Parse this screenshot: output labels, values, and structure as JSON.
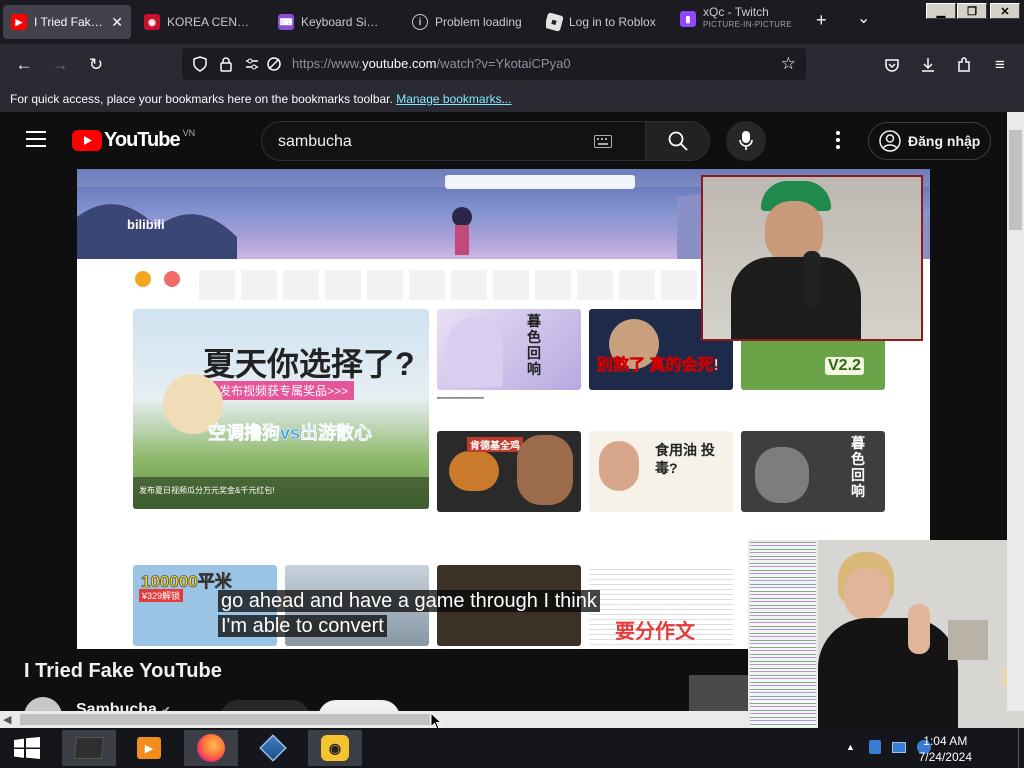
{
  "browser": {
    "tabs": [
      {
        "label": "I Tried Fake YouTube",
        "icon": "youtube-icon",
        "active": true
      },
      {
        "label": "KOREA CENTRAL",
        "icon": "korea-central-icon"
      },
      {
        "label": "Keyboard Simulator",
        "icon": "keyboard-app-icon"
      },
      {
        "label": "Problem loading",
        "icon": "info-icon"
      },
      {
        "label": "Log in to Roblox",
        "icon": "roblox-icon"
      },
      {
        "label": "xQc - Twitch",
        "sublabel": "PICTURE-IN-PICTURE",
        "icon": "twitch-icon"
      }
    ],
    "new_tab_symbol": "+",
    "tab_list_symbol": "⌄",
    "window_controls": {
      "minimize": "▁",
      "maximize": "❐",
      "close": "✕"
    },
    "url_dim_prefix": "https://www.",
    "url_host": "youtube.com",
    "url_dim_suffix": "/watch?v=YkotaiCPya0",
    "bookmarks_text": "For quick access, place your bookmarks here on the bookmarks toolbar.",
    "bookmarks_link": "Manage bookmarks..."
  },
  "youtube": {
    "logo_text": "YouTube",
    "region": "VN",
    "search_query": "sambucha",
    "signin_label": "Đăng nhập",
    "video_title": "I Tried Fake YouTube",
    "channel_name": "Sambucha",
    "subtitle_line1": "go ahead and have a game through I think",
    "subtitle_line2": "I'm able to convert"
  },
  "video_frame": {
    "site_logo": "bilibili",
    "hero_caption_top": "夏天你选择了?",
    "hero_caption_sub": "发布视频获专属奖品>>>",
    "hero_caption_bottom": "空调撸狗vs出游散心",
    "hero_footer": "发布夏日视频瓜分万元奖金&千元红包!",
    "thumb_texts": [
      "暮色回响",
      "别熬了 真的会死!",
      "V2.2",
      "肯德基全鸡",
      "食用油 投毒?",
      "暮色回响",
      "100000平米",
      "¥329解锁",
      "要分作文"
    ]
  },
  "taskbar": {
    "clock_time": "1:04 AM",
    "clock_date": "7/24/2024",
    "apps": [
      "windows-start-icon",
      "file-explorer-icon",
      "media-player-icon",
      "firefox-icon",
      "virtualbox-icon",
      "parsec-icon"
    ]
  },
  "colors": {
    "yt_red": "#ff0000",
    "twitch_purple": "#9146ff",
    "link_blue": "#80ebff",
    "pip_border_red": "#8b1a1a"
  }
}
